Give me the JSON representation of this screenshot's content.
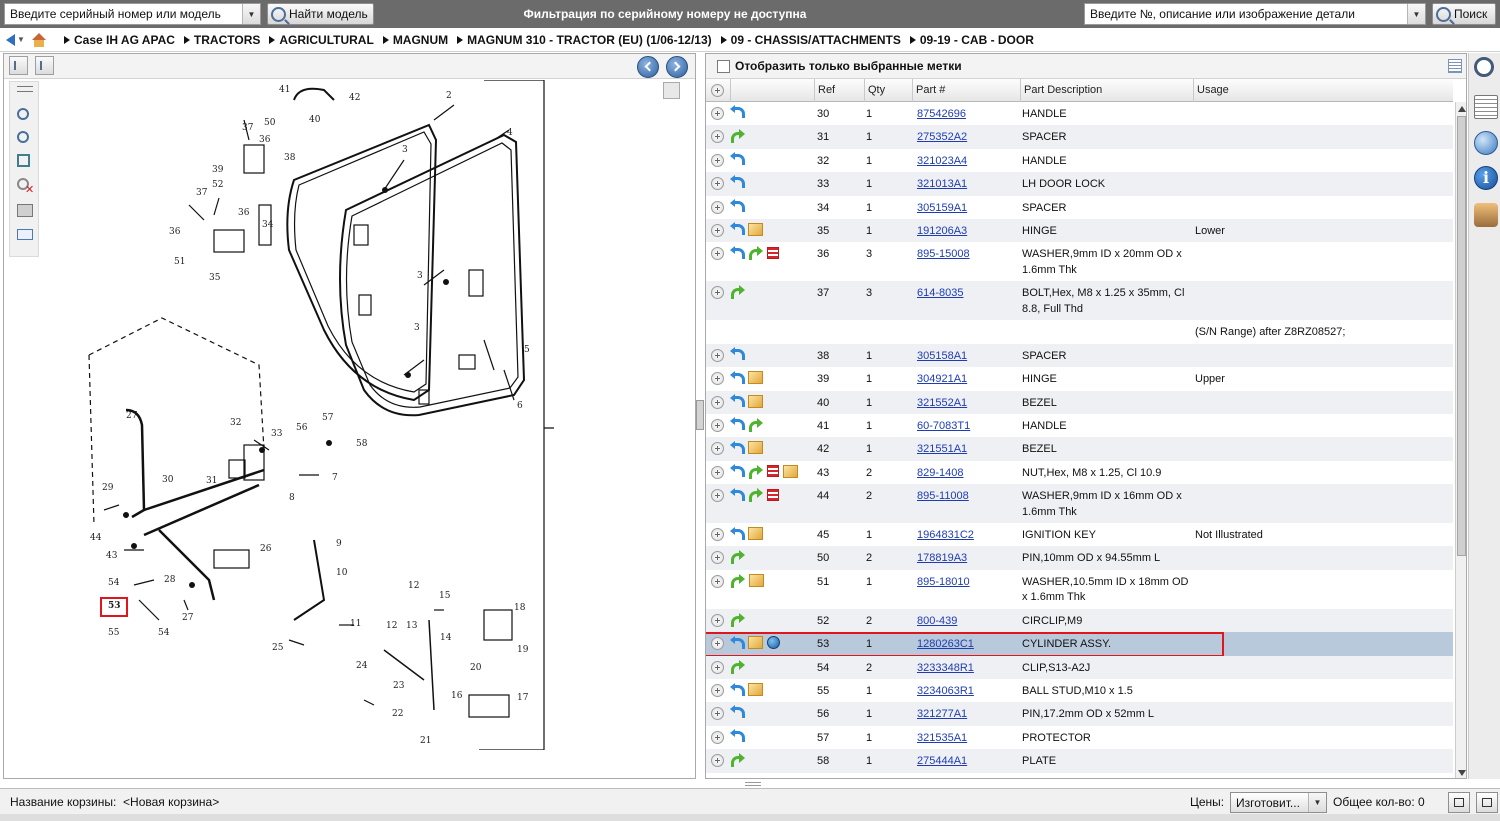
{
  "topbar": {
    "serial_placeholder": "Введите серийный номер или модель",
    "find_model_label": "Найти модель",
    "center_message": "Фильтрация по серийному номеру не доступна",
    "part_search_placeholder": "Введите №, описание или изображение детали",
    "search_label": "Поиск"
  },
  "breadcrumb": [
    "Case IH AG APAC",
    "TRACTORS",
    "AGRICULTURAL",
    "MAGNUM",
    "MAGNUM 310 - TRACTOR (EU) (1/06-12/13)",
    "09 - CHASSIS/ATTACHMENTS",
    "09-19 - CAB - DOOR"
  ],
  "right_header": {
    "show_selected_label": "Отобразить только выбранные метки"
  },
  "table": {
    "columns": [
      "Ref",
      "Qty",
      "Part #",
      "Part Description",
      "Usage"
    ],
    "rows": [
      {
        "icons": [
          "back"
        ],
        "ref": "30",
        "qty": "1",
        "part": "87542696",
        "desc": "HANDLE",
        "usage": ""
      },
      {
        "icons": [
          "fwd"
        ],
        "ref": "31",
        "qty": "1",
        "part": "275352A2",
        "desc": "SPACER",
        "usage": ""
      },
      {
        "icons": [
          "back"
        ],
        "ref": "32",
        "qty": "1",
        "part": "321023A4",
        "desc": "HANDLE",
        "usage": ""
      },
      {
        "icons": [
          "back"
        ],
        "ref": "33",
        "qty": "1",
        "part": "321013A1",
        "desc": "LH DOOR LOCK",
        "usage": ""
      },
      {
        "icons": [
          "back"
        ],
        "ref": "34",
        "qty": "1",
        "part": "305159A1",
        "desc": "SPACER",
        "usage": ""
      },
      {
        "icons": [
          "back",
          "box"
        ],
        "ref": "35",
        "qty": "1",
        "part": "191206A3",
        "desc": "HINGE",
        "usage": "Lower"
      },
      {
        "icons": [
          "back",
          "fwd",
          "bars"
        ],
        "ref": "36",
        "qty": "3",
        "part": "895-15008",
        "desc": "WASHER,9mm ID x 20mm OD x 1.6mm Thk",
        "usage": "",
        "tall": true
      },
      {
        "icons": [
          "fwd"
        ],
        "ref": "37",
        "qty": "3",
        "part": "614-8035",
        "desc": "BOLT,Hex, M8 x 1.25 x 35mm, Cl 8.8, Full Thd",
        "usage": "",
        "tall": true
      },
      {
        "icons": [],
        "ref": "",
        "qty": "",
        "part": "",
        "desc": "",
        "usage": "(S/N Range) after Z8RZ08527;",
        "noplus": true
      },
      {
        "icons": [
          "back"
        ],
        "ref": "38",
        "qty": "1",
        "part": "305158A1",
        "desc": "SPACER",
        "usage": ""
      },
      {
        "icons": [
          "back",
          "box"
        ],
        "ref": "39",
        "qty": "1",
        "part": "304921A1",
        "desc": "HINGE",
        "usage": "Upper"
      },
      {
        "icons": [
          "back",
          "box"
        ],
        "ref": "40",
        "qty": "1",
        "part": "321552A1",
        "desc": "BEZEL",
        "usage": ""
      },
      {
        "icons": [
          "back",
          "fwd"
        ],
        "ref": "41",
        "qty": "1",
        "part": "60-7083T1",
        "desc": "HANDLE",
        "usage": ""
      },
      {
        "icons": [
          "back",
          "box"
        ],
        "ref": "42",
        "qty": "1",
        "part": "321551A1",
        "desc": "BEZEL",
        "usage": ""
      },
      {
        "icons": [
          "back",
          "fwd",
          "bars",
          "box"
        ],
        "ref": "43",
        "qty": "2",
        "part": "829-1408",
        "desc": "NUT,Hex, M8 x 1.25, Cl 10.9",
        "usage": ""
      },
      {
        "icons": [
          "back",
          "fwd",
          "bars"
        ],
        "ref": "44",
        "qty": "2",
        "part": "895-11008",
        "desc": "WASHER,9mm ID x 16mm OD x 1.6mm Thk",
        "usage": "",
        "tall": true
      },
      {
        "icons": [
          "back",
          "box"
        ],
        "ref": "45",
        "qty": "1",
        "part": "1964831C2",
        "desc": "IGNITION KEY",
        "usage": "Not Illustrated"
      },
      {
        "icons": [
          "fwd"
        ],
        "ref": "50",
        "qty": "2",
        "part": "178819A3",
        "desc": "PIN,10mm OD x 94.55mm L",
        "usage": ""
      },
      {
        "icons": [
          "fwd",
          "box"
        ],
        "ref": "51",
        "qty": "1",
        "part": "895-18010",
        "desc": "WASHER,10.5mm ID x 18mm OD x 1.6mm Thk",
        "usage": "",
        "tall": true
      },
      {
        "icons": [
          "fwd"
        ],
        "ref": "52",
        "qty": "2",
        "part": "800-439",
        "desc": "CIRCLIP,M9",
        "usage": ""
      },
      {
        "icons": [
          "back",
          "box",
          "globe"
        ],
        "ref": "53",
        "qty": "1",
        "part": "1280263C1",
        "desc": "CYLINDER ASSY.",
        "usage": "",
        "selected": true
      },
      {
        "icons": [
          "fwd"
        ],
        "ref": "54",
        "qty": "2",
        "part": "3233348R1",
        "desc": "CLIP,S13-A2J",
        "usage": ""
      },
      {
        "icons": [
          "back",
          "box"
        ],
        "ref": "55",
        "qty": "1",
        "part": "3234063R1",
        "desc": "BALL STUD,M10 x 1.5",
        "usage": ""
      },
      {
        "icons": [
          "back"
        ],
        "ref": "56",
        "qty": "1",
        "part": "321277A1",
        "desc": "PIN,17.2mm OD x 52mm L",
        "usage": ""
      },
      {
        "icons": [
          "back"
        ],
        "ref": "57",
        "qty": "1",
        "part": "321535A1",
        "desc": "PROTECTOR",
        "usage": ""
      },
      {
        "icons": [
          "fwd"
        ],
        "ref": "58",
        "qty": "1",
        "part": "275444A1",
        "desc": "PLATE",
        "usage": ""
      }
    ]
  },
  "diagram": {
    "labels": [
      "1",
      "2",
      "3",
      "4",
      "5",
      "6",
      "7",
      "8",
      "9",
      "10",
      "11",
      "12",
      "13",
      "14",
      "15",
      "16",
      "17",
      "18",
      "19",
      "20",
      "21",
      "22",
      "23",
      "24",
      "25",
      "26",
      "27",
      "28",
      "29",
      "30",
      "31",
      "32",
      "33",
      "34",
      "35",
      "36",
      "37",
      "38",
      "39",
      "40",
      "41",
      "42",
      "43",
      "44",
      "50",
      "51",
      "52",
      "53",
      "54",
      "55",
      "56",
      "57",
      "58"
    ],
    "highlighted_ref": "53"
  },
  "bottombar": {
    "basket_label": "Название корзины:",
    "basket_value": "<Новая корзина>",
    "prices_label": "Цены:",
    "prices_value": "Изготовит...",
    "total_label": "Общее кол-во: 0"
  },
  "colors": {
    "topbar": "#6b6b6b",
    "highlight": "#e0161c",
    "selected_row": "#b8c9dc",
    "link": "#1f3db3"
  }
}
